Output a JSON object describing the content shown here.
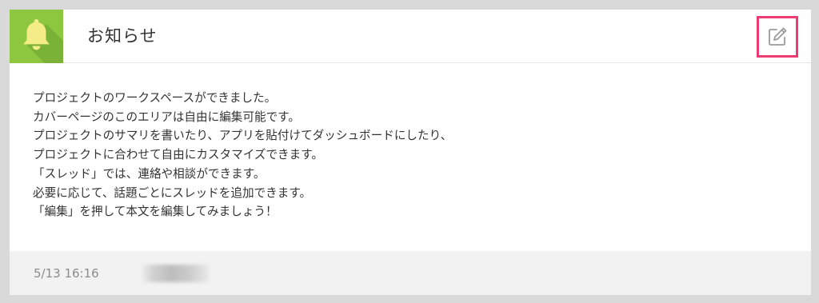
{
  "notice": {
    "title": "お知らせ",
    "edit_icon": "edit-pencil-icon",
    "bell_icon": "bell-icon",
    "body_lines": [
      "プロジェクトのワークスペースができました。",
      "カバーページのこのエリアは自由に編集可能です。",
      "プロジェクトのサマリを書いたり、アプリを貼付けてダッシュボードにしたり、",
      "プロジェクトに合わせて自由にカスタマイズできます。",
      "「スレッド」では、連絡や相談ができます。",
      "必要に応じて、話題ごとにスレッドを追加できます。",
      "「編集」を押して本文を編集してみましょう！"
    ],
    "timestamp": "5/13 16:16"
  },
  "colors": {
    "accent_green": "#8dc63f",
    "bell_yellow": "#f4ec86",
    "highlight_pink": "#ec3d72"
  }
}
